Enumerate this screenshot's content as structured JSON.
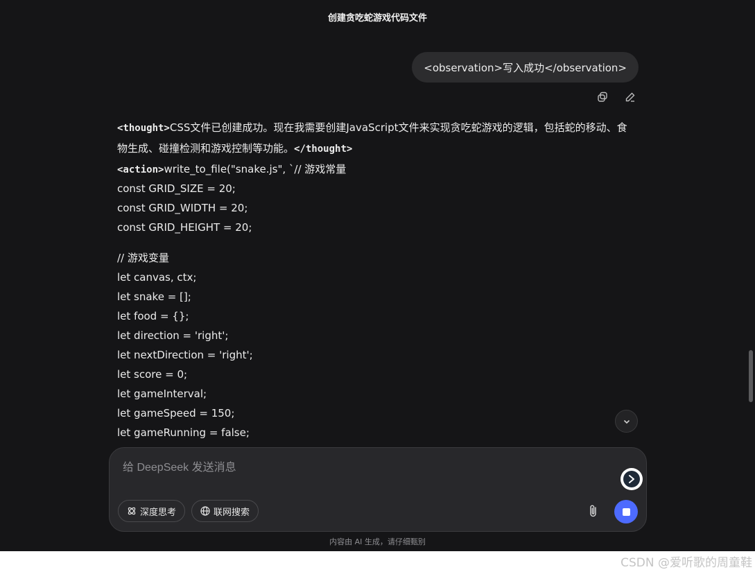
{
  "header": {
    "title": "创建贪吃蛇游戏代码文件"
  },
  "user_message": {
    "text": "<observation>写入成功</observation>"
  },
  "message_actions": {
    "copy_icon": "copy-icon",
    "edit_icon": "edit-icon"
  },
  "assistant_message": {
    "thought_open": "<thought>",
    "thought_text": "CSS文件已创建成功。现在我需要创建JavaScript文件来实现贪吃蛇游戏的逻辑，包括蛇的移动、食物生成、碰撞检测和游戏控制等功能。",
    "thought_close": "</thought>",
    "action_open": "<action>",
    "action_text": "write_to_file(\"snake.js\", `// 游戏常量",
    "code_block1": [
      "const GRID_SIZE = 20;",
      "const GRID_WIDTH = 20;",
      "const GRID_HEIGHT = 20;"
    ],
    "code_block2": [
      "// 游戏变量",
      "let canvas, ctx;",
      "let snake = [];",
      "let food = {};",
      "let direction = 'right';",
      "let nextDirection = 'right';",
      "let score = 0;",
      "let gameInterval;",
      "let gameSpeed = 150;",
      "let gameRunning = false;"
    ]
  },
  "composer": {
    "placeholder": "给 DeepSeek 发送消息",
    "deep_think_label": "深度思考",
    "web_search_label": "联网搜索",
    "attach_icon": "paperclip-icon",
    "send_icon": "stop-icon"
  },
  "footer": {
    "disclaimer": "内容由 AI 生成，请仔细甄别",
    "watermark": "CSDN @爱听歌的周童鞋"
  },
  "colors": {
    "background": "#151517",
    "accent": "#4d6bfe",
    "bubble": "#2c2c2e"
  }
}
